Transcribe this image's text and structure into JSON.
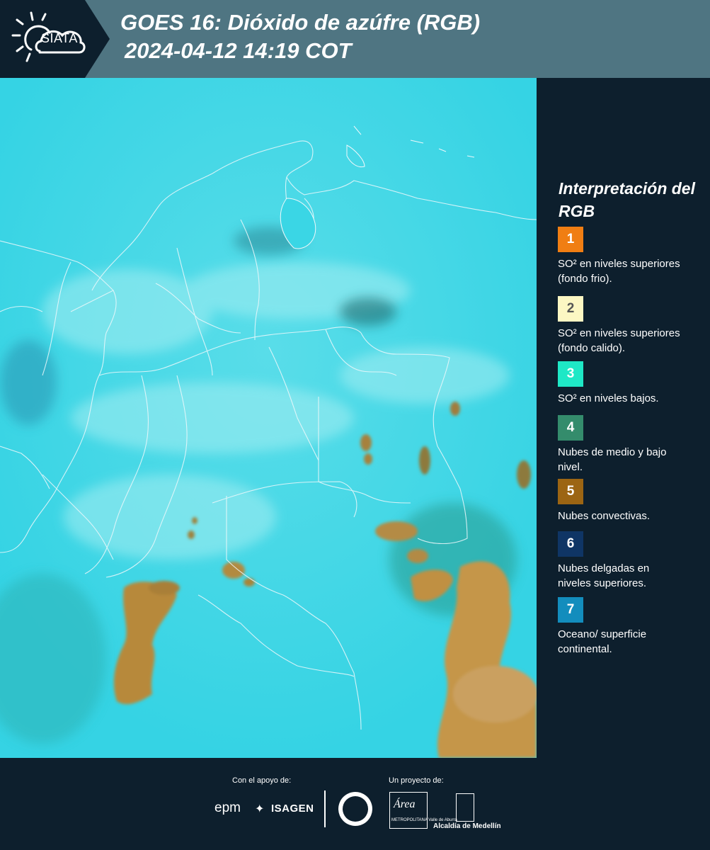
{
  "header": {
    "logo": "SIATA",
    "title_line1": "GOES 16: Dióxido de azúfre (RGB)",
    "title_line2": "2024-04-12 14:19 COT"
  },
  "legend": {
    "title": "Interpretación del RGB",
    "items": [
      {
        "number": "1",
        "color": "#f07e13",
        "text_color": "#ffffff",
        "label": "SO² en niveles superiores (fondo frio)."
      },
      {
        "number": "2",
        "color": "#fcf7c3",
        "text_color": "#555555",
        "label": "SO² en niveles superiores (fondo calido)."
      },
      {
        "number": "3",
        "color": "#1ee8c6",
        "text_color": "#ffffff",
        "label": "SO² en niveles bajos."
      },
      {
        "number": "4",
        "color": "#348c6c",
        "text_color": "#ffffff",
        "label": "Nubes de medio y bajo nivel."
      },
      {
        "number": "5",
        "color": "#9c6513",
        "text_color": "#ffffff",
        "label": "Nubes convectivas."
      },
      {
        "number": "6",
        "color": "#0f3565",
        "text_color": "#ffffff",
        "label": "Nubes delgadas en niveles superiores."
      },
      {
        "number": "7",
        "color": "#138dbd",
        "text_color": "#ffffff",
        "label": "Oceano/ superficie continental."
      }
    ]
  },
  "footer": {
    "support_label": "Con el apoyo de:",
    "project_label": "Un proyecto de:",
    "epm": "epm",
    "isagen": "ISAGEN",
    "area_logo": "Área",
    "area_sub": "METROPOLITANA Valle de Aburrá",
    "alcaldia": "Alcaldía de Medellín"
  }
}
